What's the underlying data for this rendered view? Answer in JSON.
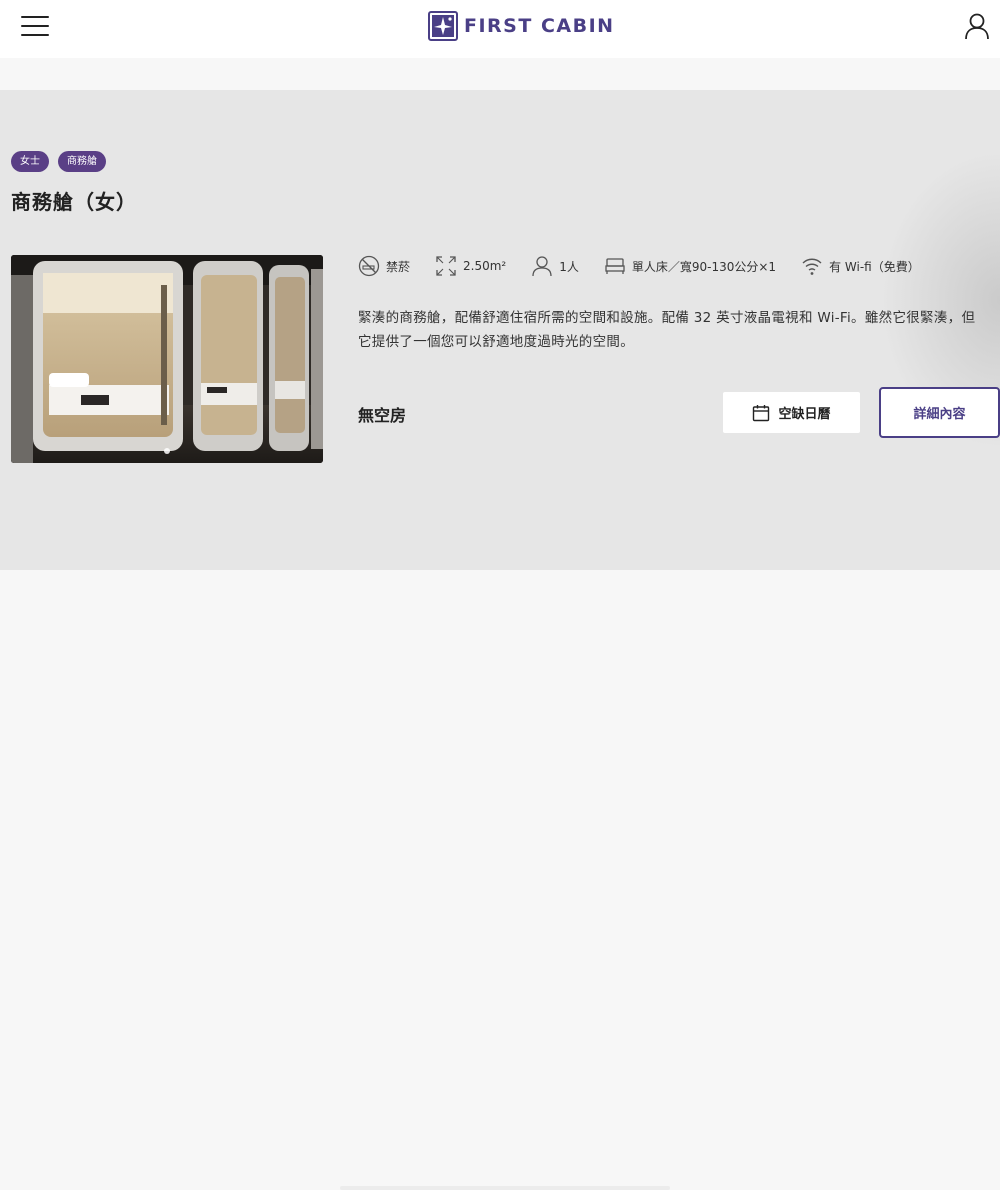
{
  "header": {
    "logo_text": "FIRST CABIN",
    "menu_icon": "hamburger-menu-icon",
    "user_icon": "user-profile-icon"
  },
  "room": {
    "tags": [
      "女士",
      "商務艙"
    ],
    "title": "商務艙（女）",
    "features": {
      "smoking": "禁菸",
      "area": "2.50m²",
      "capacity": "1人",
      "bed": "單人床／寬90-130公分×1",
      "wifi": "有 Wi-fi（免費）"
    },
    "description": "緊湊的商務艙，配備舒適住宿所需的空間和設施。配備 32 英寸液晶電視和 Wi-Fi。雖然它很緊湊，但它提供了一個您可以舒適地度過時光的空間。",
    "availability": "無空房",
    "calendar_button": "空缺日曆",
    "detail_button": "詳細內容"
  },
  "colors": {
    "brand_purple": "#4a3f86",
    "tag_purple": "#5a3f86",
    "card_background": "#e6e6e6",
    "page_background": "#f7f7f7"
  }
}
